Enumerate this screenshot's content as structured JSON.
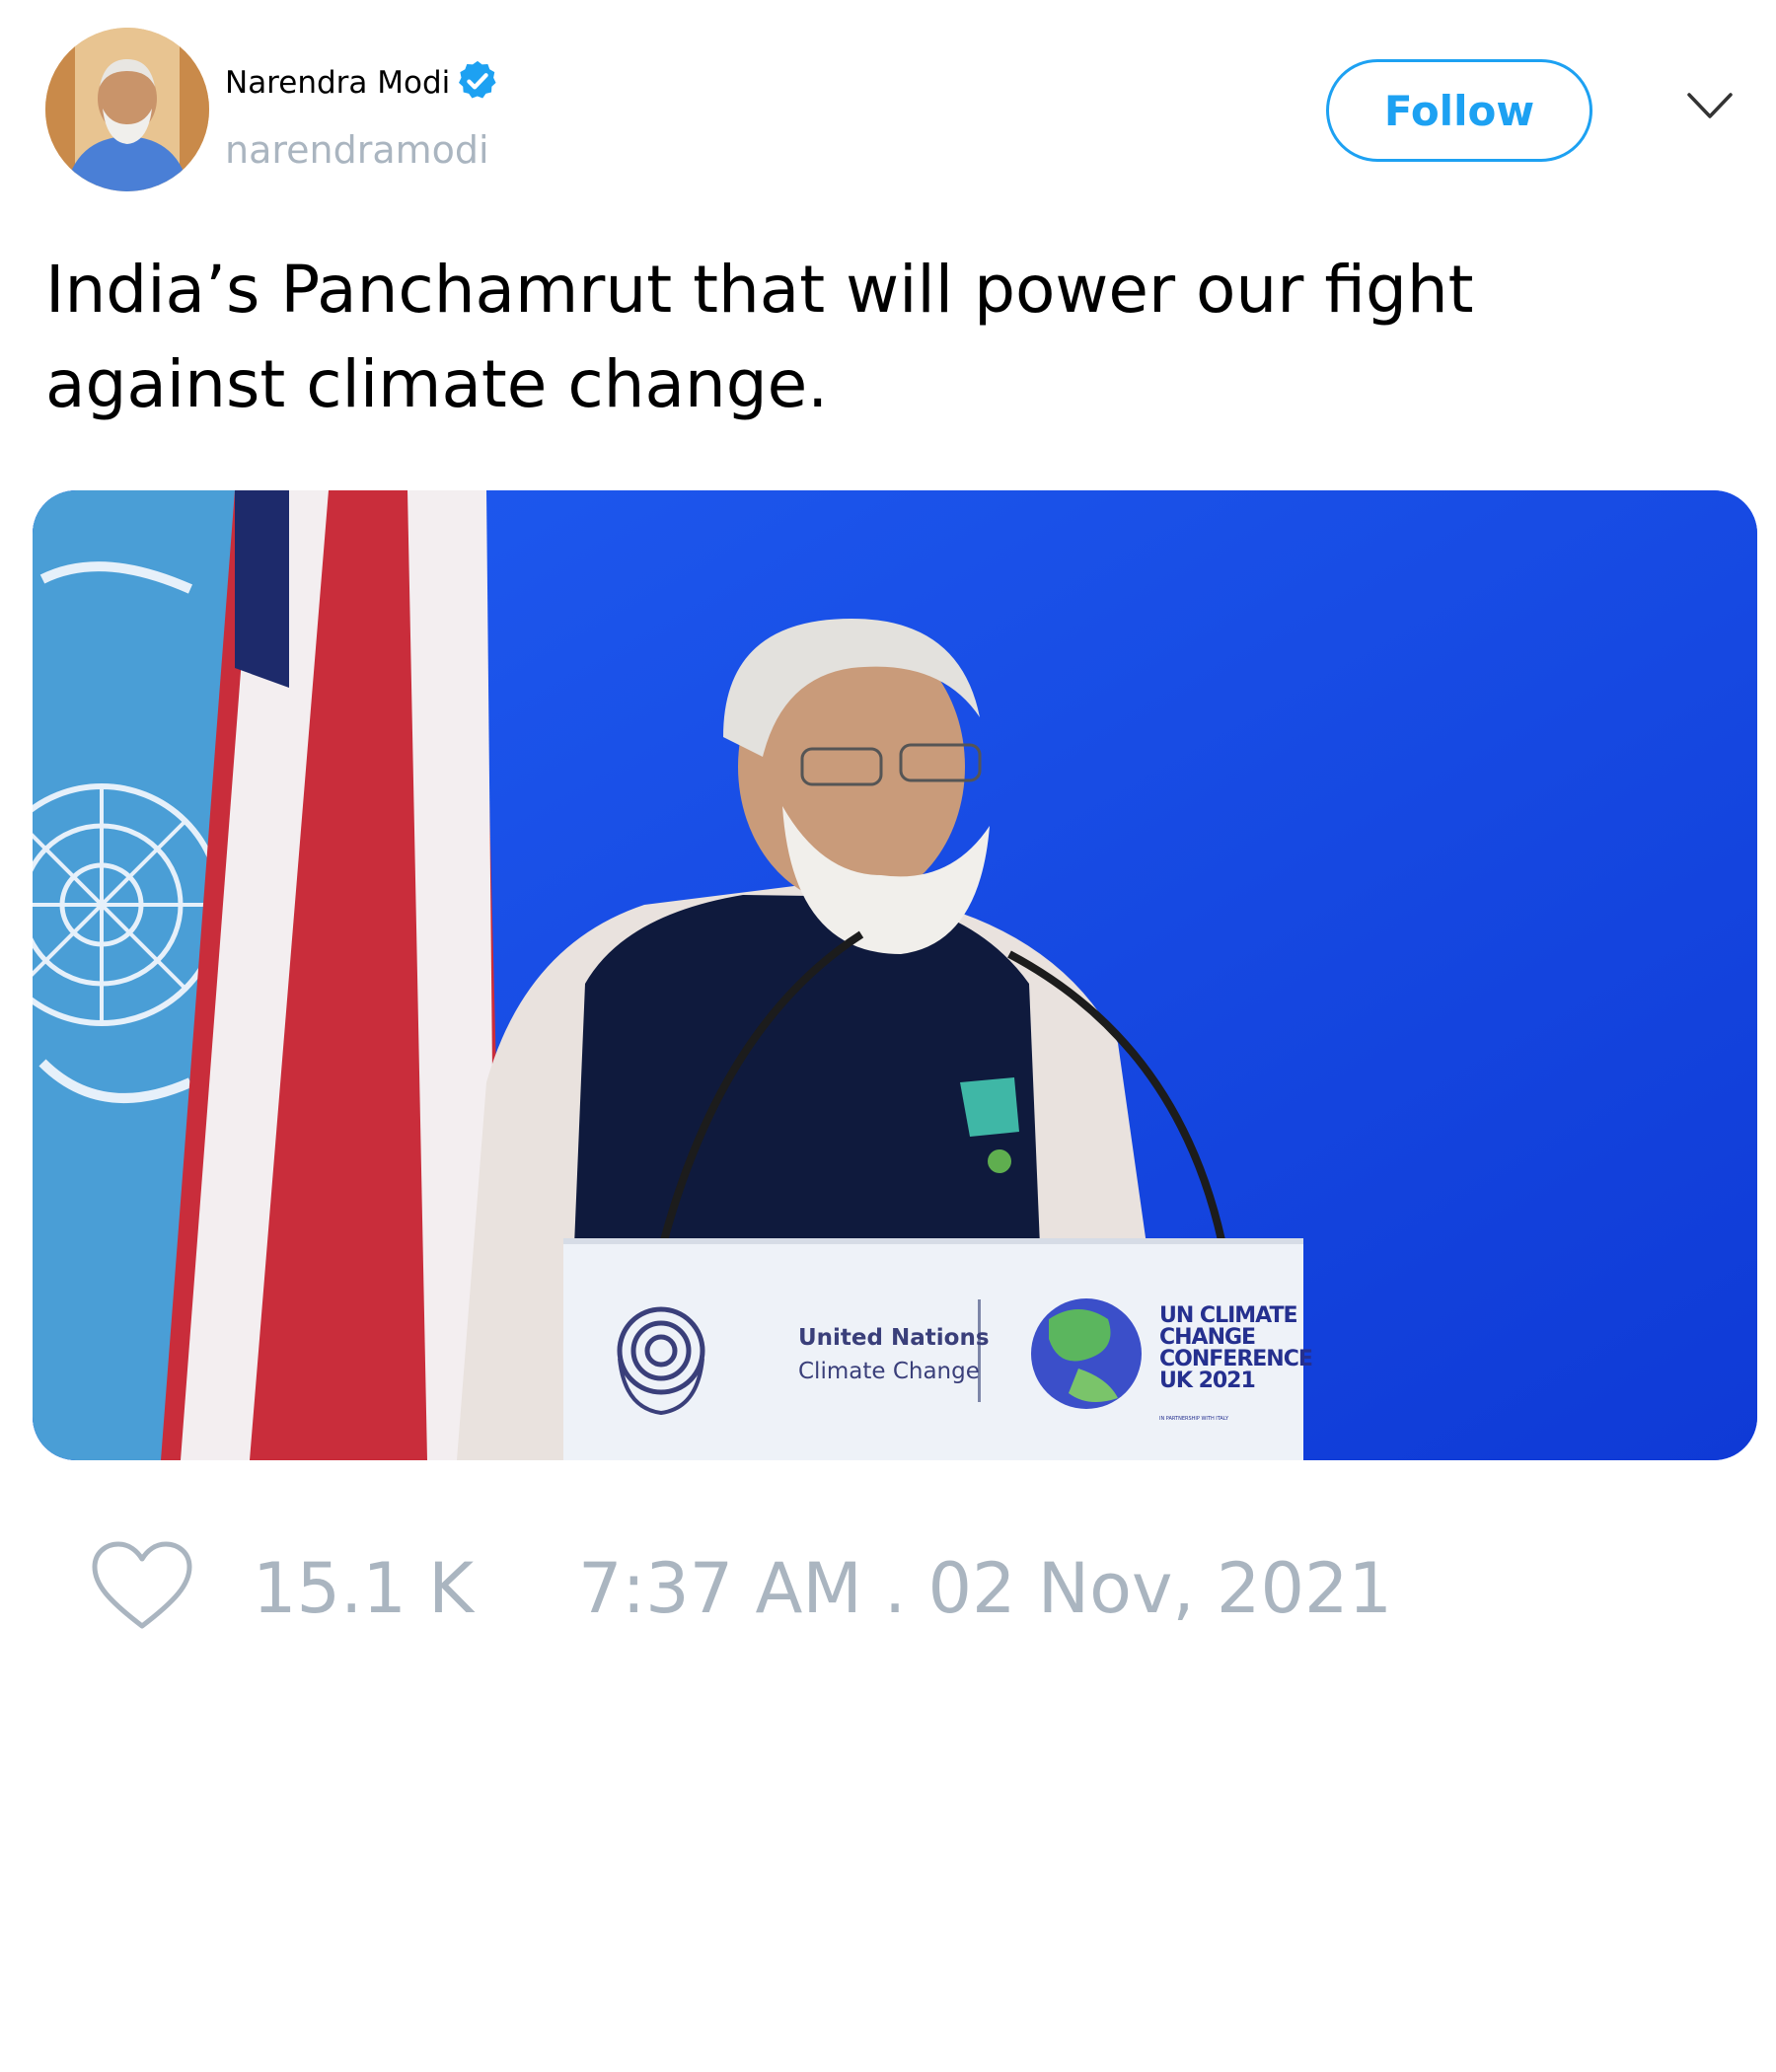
{
  "user": {
    "display_name": "Narendra Modi",
    "handle": "narendramodi",
    "verified": true
  },
  "actions": {
    "follow_label": "Follow",
    "menu_icon": "chevron-down-icon"
  },
  "tweet": {
    "text": "India’s Panchamrut that will power our fight against climate change."
  },
  "media": {
    "podium_left_line1": "United Nations",
    "podium_left_line2": "Climate Change",
    "podium_right_lines": [
      "UN CLIMATE",
      "CHANGE",
      "CONFERENCE",
      "UK 2021"
    ],
    "podium_right_small": "IN PARTNERSHIP WITH ITALY"
  },
  "stats": {
    "likes": "15.1 K",
    "timestamp": "7:37 AM . 02 Nov, 2021"
  },
  "colors": {
    "accent": "#1da1f2",
    "muted": "#aab5c0",
    "stage_blue": "#1447e6"
  }
}
